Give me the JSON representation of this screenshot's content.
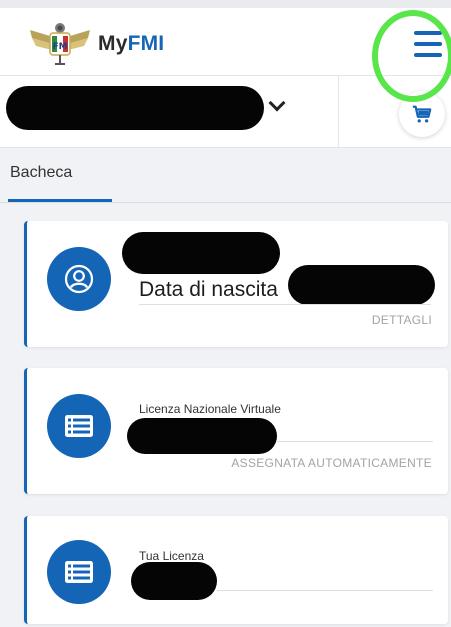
{
  "header": {
    "brand_prefix": "My",
    "brand_suffix": "FMI",
    "logo_icon": "fmi-winged-logo-icon",
    "menu_icon": "hamburger-menu-icon"
  },
  "account": {
    "chevron_icon": "chevron-down-icon",
    "cart_icon": "shopping-cart-icon"
  },
  "tabs": [
    {
      "label": "Bacheca",
      "active": true
    }
  ],
  "cards": {
    "profile": {
      "icon": "user-avatar-icon",
      "field_label": "Data di nascita",
      "action": "DETTAGLI"
    },
    "virtual_license": {
      "icon": "license-card-icon",
      "title": "Licenza Nazionale Virtuale",
      "action": "ASSEGNATA AUTOMATICAMENTE"
    },
    "my_license": {
      "icon": "license-card-icon",
      "title": "Tua Licenza"
    }
  },
  "colors": {
    "brand_blue": "#1565b7",
    "annotation_green": "#59e64a",
    "redaction": "#050505"
  }
}
